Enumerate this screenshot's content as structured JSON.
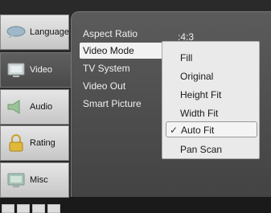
{
  "sidebar": {
    "tabs": [
      {
        "label": "Language",
        "icon": "speech-bubble-icon"
      },
      {
        "label": "Video",
        "icon": "monitor-icon"
      },
      {
        "label": "Audio",
        "icon": "speaker-icon"
      },
      {
        "label": "Rating",
        "icon": "lock-icon"
      },
      {
        "label": "Misc",
        "icon": "monitor-icon"
      }
    ],
    "active": "Video"
  },
  "settings": {
    "rows": [
      "Aspect Ratio",
      "Video Mode",
      "TV System",
      "Video Out",
      "Smart Picture"
    ],
    "selected": "Video Mode",
    "aspect_ratio_value": ":4:3"
  },
  "dropdown": {
    "options": [
      "Fill",
      "Original",
      "Height Fit",
      "Width Fit",
      "Auto Fit",
      "Pan Scan"
    ],
    "checked": "Auto Fit",
    "check_mark": "✓"
  },
  "colors": {
    "panel": "#4f4f4f",
    "active_tab": "#555555",
    "highlight": "#f2f2f2"
  }
}
